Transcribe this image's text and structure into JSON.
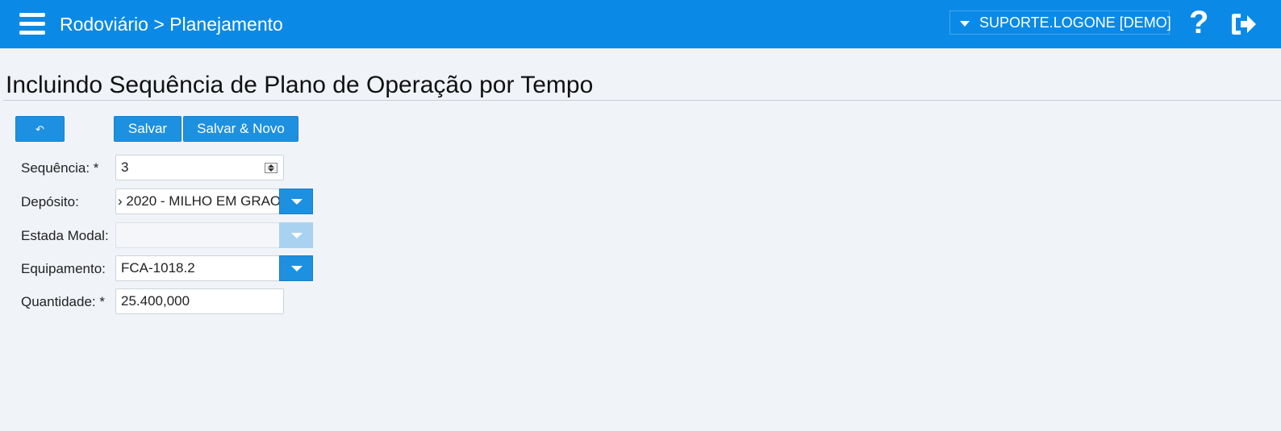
{
  "header": {
    "breadcrumb": "Rodoviário > Planejamento",
    "user": "SUPORTE.LOGONE [DEMO]",
    "help_glyph": "?",
    "accent_color": "#0a8ae6"
  },
  "page": {
    "title": "Incluindo Sequência de Plano de Operação por Tempo"
  },
  "toolbar": {
    "back_glyph": "↶",
    "save_label": "Salvar",
    "save_new_label": "Salvar & Novo"
  },
  "form": {
    "sequencia": {
      "label": "Sequência: *",
      "value": "3"
    },
    "deposito": {
      "label": "Depósito:",
      "value": "› 2020 - MILHO EM GRAO"
    },
    "estada_modal": {
      "label": "Estada Modal:",
      "value": ""
    },
    "equipamento": {
      "label": "Equipamento:",
      "value": "FCA-1018.2"
    },
    "quantidade": {
      "label": "Quantidade: *",
      "value": "25.400,000"
    }
  },
  "icons": [
    "menu-icon",
    "caret-down-icon",
    "help-icon",
    "logout-icon",
    "undo-icon",
    "spinner-icon",
    "dropdown-arrow-icon"
  ]
}
